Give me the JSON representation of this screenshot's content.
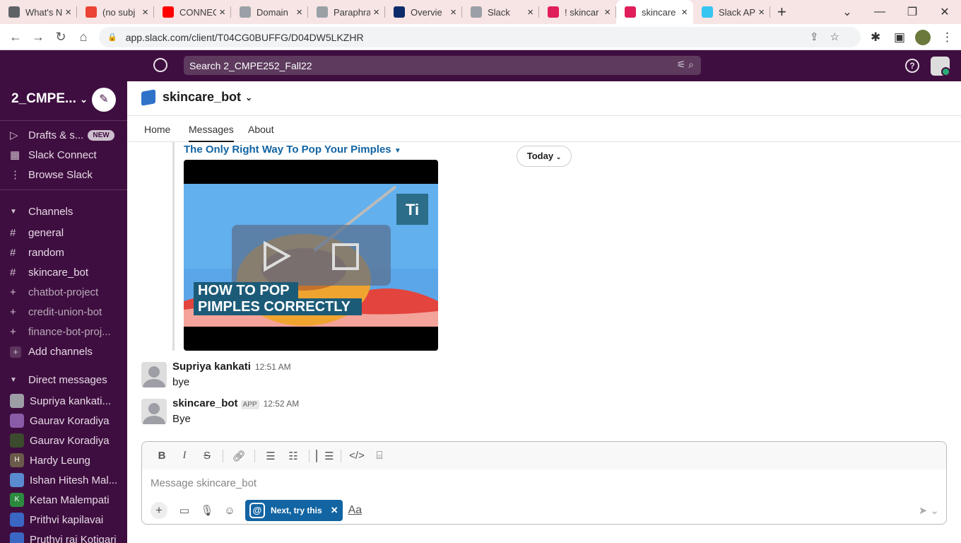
{
  "browser": {
    "tabs": [
      {
        "label": "What's N",
        "color": "#5f6368"
      },
      {
        "label": "(no subj",
        "color": "#ea4335"
      },
      {
        "label": "CONNEC",
        "color": "#ff0000"
      },
      {
        "label": "Domain",
        "color": "#9aa0a6"
      },
      {
        "label": "Paraphra",
        "color": "#9aa0a6"
      },
      {
        "label": "Overvie",
        "color": "#0d2b6b"
      },
      {
        "label": "Slack",
        "color": "#9aa0a6"
      },
      {
        "label": "! skincar",
        "color": "#e01e5a"
      },
      {
        "label": "skincare",
        "color": "#e01e5a"
      },
      {
        "label": "Slack AP",
        "color": "#36c5f0"
      }
    ],
    "url": "app.slack.com/client/T04CG0BUFFG/D04DW5LKZHR"
  },
  "slack": {
    "search_text": "Search 2_CMPE252_Fall22",
    "workspace": "2_CMPE...",
    "sidebar": {
      "top_items": [
        {
          "icon": "drafts-icon",
          "glyph": "▷",
          "label": "Drafts & s...",
          "badge": "NEW"
        },
        {
          "icon": "slack-connect-icon",
          "glyph": "▦",
          "label": "Slack Connect"
        },
        {
          "icon": "browse-icon",
          "glyph": "⋮",
          "label": "Browse Slack"
        }
      ],
      "channels_header": "Channels",
      "channels": [
        {
          "label": "general",
          "glyph": "#",
          "dim": false
        },
        {
          "label": "random",
          "glyph": "#",
          "dim": false
        },
        {
          "label": "skincare_bot",
          "glyph": "#",
          "dim": false
        },
        {
          "label": "chatbot-project",
          "glyph": "+",
          "dim": true
        },
        {
          "label": "credit-union-bot",
          "glyph": "+",
          "dim": true
        },
        {
          "label": "finance-bot-proj...",
          "glyph": "+",
          "dim": true
        }
      ],
      "add_channels": "Add channels",
      "dm_header": "Direct messages",
      "dms": [
        {
          "label": "Supriya kankati...",
          "avatar_color": "#9e9ea6",
          "initial": ""
        },
        {
          "label": "Gaurav Koradiya",
          "avatar_color": "#8a5ba8",
          "initial": ""
        },
        {
          "label": "Gaurav Koradiya",
          "avatar_color": "#3c4a2e",
          "initial": ""
        },
        {
          "label": "Hardy Leung",
          "avatar_color": "#6b5a4a",
          "initial": "H"
        },
        {
          "label": "Ishan Hitesh Mal...",
          "avatar_color": "#5a8ad0",
          "initial": ""
        },
        {
          "label": "Ketan Malempati",
          "avatar_color": "#2b8a3e",
          "initial": "K"
        },
        {
          "label": "Prithvi kapilavai",
          "avatar_color": "#3a66c4",
          "initial": ""
        },
        {
          "label": "Pruthvi raj Kotigari",
          "avatar_color": "#3a66c4",
          "initial": ""
        }
      ]
    },
    "channel": {
      "name": "skincare_bot",
      "tabs": [
        "Home",
        "Messages",
        "About"
      ],
      "video_title": "The Only Right Way To Pop Your Pimples",
      "video_caption_line1": "HOW TO POP",
      "video_caption_line2": "PIMPLES CORRECTLY",
      "video_logo": "Ti",
      "date_divider": "Today",
      "messages": [
        {
          "author": "Supriya kankati",
          "time": "12:51 AM",
          "text": "bye",
          "app": ""
        },
        {
          "author": "skincare_bot",
          "time": "12:52 AM",
          "text": "Bye",
          "app": "APP"
        }
      ]
    },
    "composer": {
      "placeholder": "Message skincare_bot",
      "hint": "Next, try this",
      "text_format": "Aa"
    }
  }
}
